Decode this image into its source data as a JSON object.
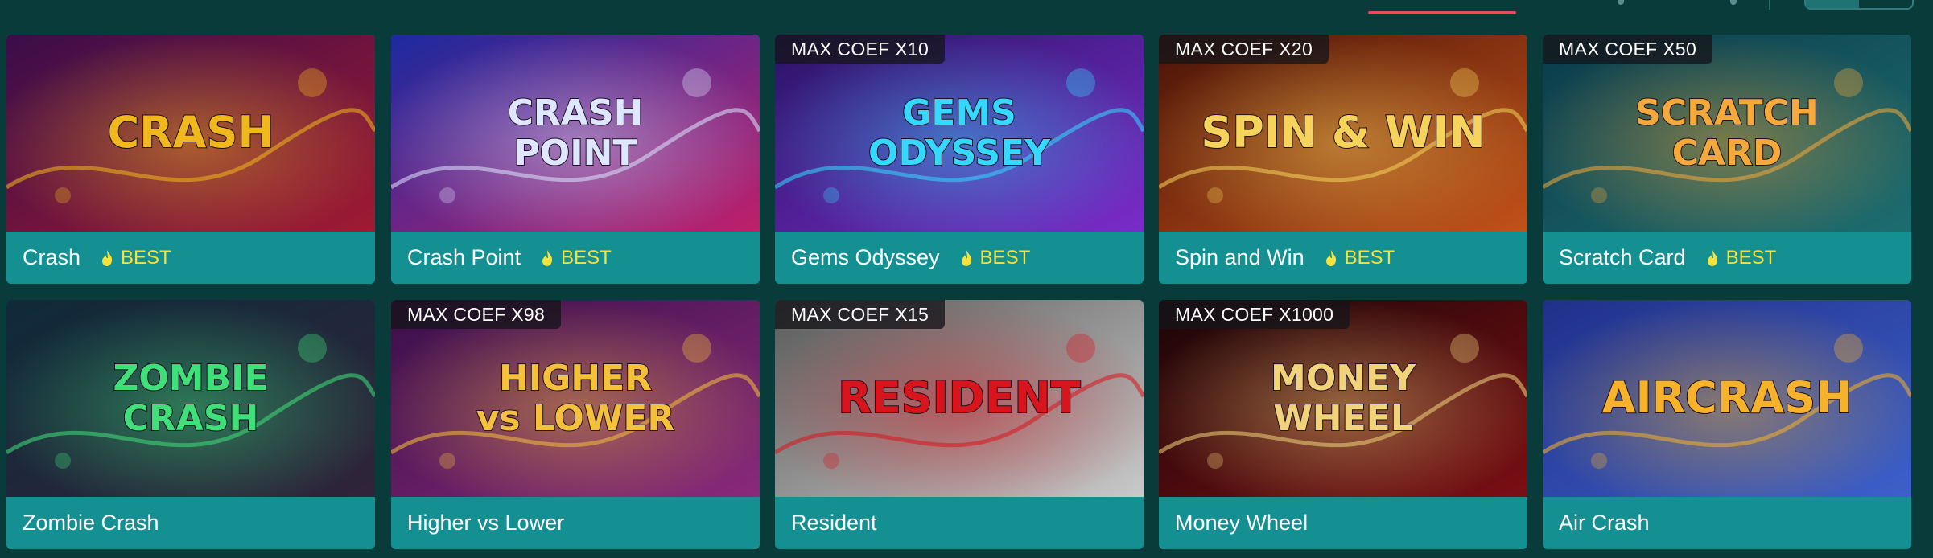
{
  "cards": [
    {
      "name": "Crash",
      "coef": "",
      "badge": "BEST",
      "logo": [
        "CRASH"
      ],
      "colors": {
        "a": "#3a0d4a",
        "b": "#a01a32",
        "c": "#f0b81c"
      }
    },
    {
      "name": "Crash Point",
      "coef": "",
      "badge": "BEST",
      "logo": [
        "CRASH",
        "POINT"
      ],
      "colors": {
        "a": "#1b2aa0",
        "b": "#c0206a",
        "c": "#dfe6ff"
      }
    },
    {
      "name": "Gems Odyssey",
      "coef": "MAX COEF X10",
      "badge": "BEST",
      "logo": [
        "GEMS",
        "ODYSSEY"
      ],
      "colors": {
        "a": "#2a1467",
        "b": "#7a2cc9",
        "c": "#35d8ff"
      }
    },
    {
      "name": "Spin and Win",
      "coef": "MAX COEF X20",
      "badge": "BEST",
      "logo": [
        "SPIN & WIN"
      ],
      "colors": {
        "a": "#4a1308",
        "b": "#c2521a",
        "c": "#f6d35a"
      }
    },
    {
      "name": "Scratch Card",
      "coef": "MAX COEF X50",
      "badge": "BEST",
      "logo": [
        "SCRATCH",
        "CARD"
      ],
      "colors": {
        "a": "#0b3b4a",
        "b": "#1d6d6f",
        "c": "#f5a93a"
      }
    },
    {
      "name": "Zombie Crash",
      "coef": "",
      "badge": "",
      "logo": [
        "ZOMBIE",
        "CRASH"
      ],
      "colors": {
        "a": "#0f2a3a",
        "b": "#30243a",
        "c": "#3fe07a"
      }
    },
    {
      "name": "Higher vs Lower",
      "coef": "MAX COEF X98",
      "badge": "",
      "logo": [
        "HIGHER",
        "vs LOWER"
      ],
      "colors": {
        "a": "#3a0f4a",
        "b": "#8a2a7a",
        "c": "#f5c03a"
      }
    },
    {
      "name": "Resident",
      "coef": "MAX COEF X15",
      "badge": "",
      "logo": [
        "RESIDENT"
      ],
      "colors": {
        "a": "#5a5a5a",
        "b": "#c9c9c9",
        "c": "#d8141c"
      }
    },
    {
      "name": "Money Wheel",
      "coef": "MAX COEF X1000",
      "badge": "",
      "logo": [
        "MONEY",
        "WHEEL"
      ],
      "colors": {
        "a": "#1a0608",
        "b": "#7a0f14",
        "c": "#f3d37a"
      }
    },
    {
      "name": "Air Crash",
      "coef": "",
      "badge": "",
      "logo": [
        "AIRCRASH"
      ],
      "colors": {
        "a": "#20308a",
        "b": "#3d60c9",
        "c": "#f5b22a"
      }
    }
  ]
}
